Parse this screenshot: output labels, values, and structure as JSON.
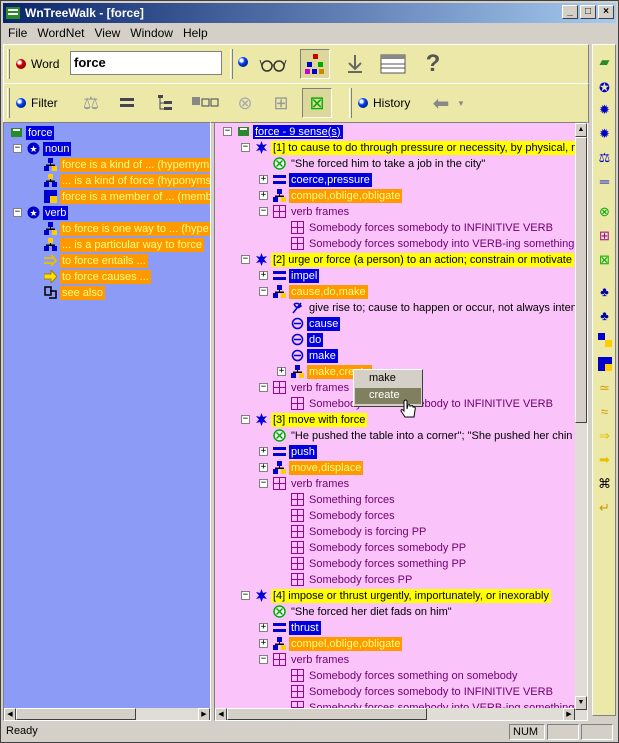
{
  "window": {
    "title": "WnTreeWalk - [force]"
  },
  "menu": [
    "File",
    "WordNet",
    "View",
    "Window",
    "Help"
  ],
  "toolbar": {
    "word_label": "Word",
    "word_value": "force",
    "filter_label": "Filter",
    "history_label": "History"
  },
  "left_tree": [
    {
      "text": "force",
      "style": "blue",
      "icon": "book-icon",
      "indent": 0
    },
    {
      "text": "noun",
      "style": "blue",
      "icon": "noun-star-icon",
      "indent": 1,
      "expander": "-"
    },
    {
      "text": "force is a kind of ... (hypernym",
      "style": "orange",
      "icon": "hypernym-icon",
      "indent": 2
    },
    {
      "text": "... is a kind of force (hyponyms",
      "style": "orange",
      "icon": "hyponym-icon",
      "indent": 2
    },
    {
      "text": "force is a member of ... (memb",
      "style": "orange",
      "icon": "member-icon",
      "indent": 2
    },
    {
      "text": "verb",
      "style": "blue",
      "icon": "verb-star-icon",
      "indent": 1,
      "expander": "-"
    },
    {
      "text": "to force is one way to ... (hype",
      "style": "orange",
      "icon": "hypernym-icon",
      "indent": 2
    },
    {
      "text": "... is a particular way to force",
      "style": "orange",
      "icon": "hyponym-icon",
      "indent": 2
    },
    {
      "text": "to force entails ...",
      "style": "orange",
      "icon": "entail-arrow-icon",
      "indent": 2
    },
    {
      "text": "to force causes ...",
      "style": "orange",
      "icon": "cause-arrow-icon",
      "indent": 2
    },
    {
      "text": "see also",
      "style": "orange",
      "icon": "see-also-icon",
      "indent": 2
    }
  ],
  "right_tree": [
    {
      "text": "force - 9 sense(s)",
      "style": "blue-underline",
      "icon": "book-icon",
      "indent": 0,
      "expander": "-"
    },
    {
      "text": "[1] to cause to do through pressure or necessity, by physical, mor",
      "style": "yellow",
      "icon": "sense-star-icon",
      "indent": 1,
      "expander": "-"
    },
    {
      "text": "\"She forced him to take a job in the city\"",
      "style": "plain",
      "icon": "example-icon",
      "indent": 2
    },
    {
      "text": "coerce,pressure",
      "style": "blue",
      "icon": "synonym-icon",
      "indent": 2,
      "expander": "+"
    },
    {
      "text": "compel,oblige,obligate",
      "style": "orange",
      "icon": "hypernym-icon",
      "indent": 2,
      "expander": "+"
    },
    {
      "text": "verb frames",
      "style": "purple",
      "icon": "frame-icon",
      "indent": 2,
      "expander": "-"
    },
    {
      "text": "Somebody forces somebody to INFINITIVE VERB",
      "style": "purple",
      "icon": "frame-icon",
      "indent": 3
    },
    {
      "text": "Somebody forces somebody into VERB-ing something",
      "style": "purple",
      "icon": "frame-icon",
      "indent": 3
    },
    {
      "text": "[2] urge or force (a person) to an action; constrain or motivate",
      "style": "yellow",
      "icon": "sense-star-icon",
      "indent": 1,
      "expander": "-"
    },
    {
      "text": "impel",
      "style": "blue",
      "icon": "synonym-icon",
      "indent": 2,
      "expander": "+"
    },
    {
      "text": "cause,do,make",
      "style": "orange",
      "icon": "hypernym-icon",
      "indent": 2,
      "expander": "-"
    },
    {
      "text": "give rise to; cause to happen or occur, not always intenti",
      "style": "plain",
      "icon": "definition-icon",
      "indent": 3
    },
    {
      "text": "cause",
      "style": "blue",
      "icon": "word-icon",
      "indent": 3
    },
    {
      "text": "do",
      "style": "blue",
      "icon": "word-icon",
      "indent": 3
    },
    {
      "text": "make",
      "style": "blue",
      "icon": "word-icon",
      "indent": 3
    },
    {
      "text": "make,create",
      "style": "orange",
      "icon": "hypernym-icon",
      "indent": 3,
      "expander": "+"
    },
    {
      "text": "verb frames",
      "style": "purple",
      "icon": "frame-icon",
      "indent": 2,
      "expander": "-"
    },
    {
      "text": "Somebody forces somebody to INFINITIVE VERB",
      "style": "purple",
      "icon": "frame-icon",
      "indent": 3
    },
    {
      "text": "[3] move with force",
      "style": "yellow",
      "icon": "sense-star-icon",
      "indent": 1,
      "expander": "-"
    },
    {
      "text": "\"He pushed the table into a corner\"; \"She pushed her chin o",
      "style": "plain",
      "icon": "example-icon",
      "indent": 2
    },
    {
      "text": "push",
      "style": "blue",
      "icon": "synonym-icon",
      "indent": 2,
      "expander": "+"
    },
    {
      "text": "move,displace",
      "style": "orange",
      "icon": "hypernym-icon",
      "indent": 2,
      "expander": "+"
    },
    {
      "text": "verb frames",
      "style": "purple",
      "icon": "frame-icon",
      "indent": 2,
      "expander": "-"
    },
    {
      "text": "Something forces",
      "style": "purple",
      "icon": "frame-icon",
      "indent": 3
    },
    {
      "text": "Somebody forces",
      "style": "purple",
      "icon": "frame-icon",
      "indent": 3
    },
    {
      "text": "Somebody is forcing PP",
      "style": "purple",
      "icon": "frame-icon",
      "indent": 3
    },
    {
      "text": "Somebody forces somebody PP",
      "style": "purple",
      "icon": "frame-icon",
      "indent": 3
    },
    {
      "text": "Somebody forces something PP",
      "style": "purple",
      "icon": "frame-icon",
      "indent": 3
    },
    {
      "text": "Somebody forces PP",
      "style": "purple",
      "icon": "frame-icon",
      "indent": 3
    },
    {
      "text": "[4] impose or thrust urgently, importunately, or inexorably",
      "style": "yellow",
      "icon": "sense-star-icon",
      "indent": 1,
      "expander": "-"
    },
    {
      "text": "\"She forced her diet fads on him\"",
      "style": "plain",
      "icon": "example-icon",
      "indent": 2
    },
    {
      "text": "thrust",
      "style": "blue",
      "icon": "synonym-icon",
      "indent": 2,
      "expander": "+"
    },
    {
      "text": "compel,oblige,obligate",
      "style": "orange",
      "icon": "hypernym-icon",
      "indent": 2,
      "expander": "+"
    },
    {
      "text": "verb frames",
      "style": "purple",
      "icon": "frame-icon",
      "indent": 2,
      "expander": "-"
    },
    {
      "text": "Somebody forces something on somebody",
      "style": "purple",
      "icon": "frame-icon",
      "indent": 3
    },
    {
      "text": "Somebody forces somebody to INFINITIVE VERB",
      "style": "purple",
      "icon": "frame-icon",
      "indent": 3
    },
    {
      "text": "Somebody forces somebody into VERB-ing something",
      "style": "purple",
      "icon": "frame-icon",
      "indent": 3
    }
  ],
  "context_menu": {
    "items": [
      "make",
      "create"
    ],
    "selected": "create"
  },
  "status": {
    "text": "Ready",
    "num": "NUM"
  }
}
